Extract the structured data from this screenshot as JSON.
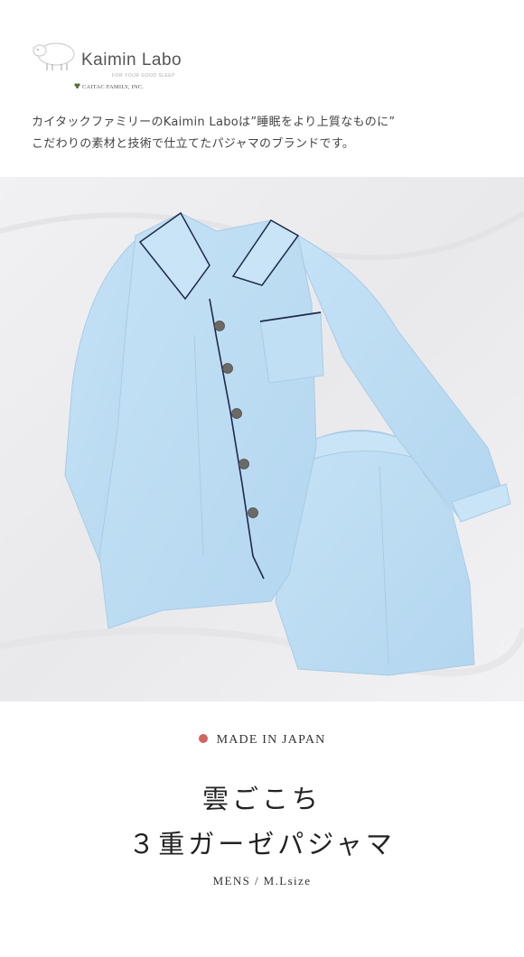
{
  "header": {
    "brand": "Kaimin Labo",
    "tagline": "FOR YOUR GOOD SLEEP",
    "company": "CAITAC FAMILY, INC.",
    "intro_line1": "カイタックファミリーのKaimin Laboは”睡眠をより上質なものに”",
    "intro_line2": "こだわりの素材と技術で仕立てたパジャマのブランドです。"
  },
  "product": {
    "made_in": "MADE IN JAPAN",
    "title_line1": "雲ごこち",
    "title_line2": "３重ガーゼパジャマ",
    "size_info": "MENS /  M.Lsize"
  },
  "colors": {
    "accent_dot": "#d0645f",
    "pajama_blue": "#bcdcf3",
    "piping_navy": "#1f2a4a"
  },
  "icons": {
    "logo": "sheep-icon",
    "company_mark": "caitac-mark-icon"
  }
}
